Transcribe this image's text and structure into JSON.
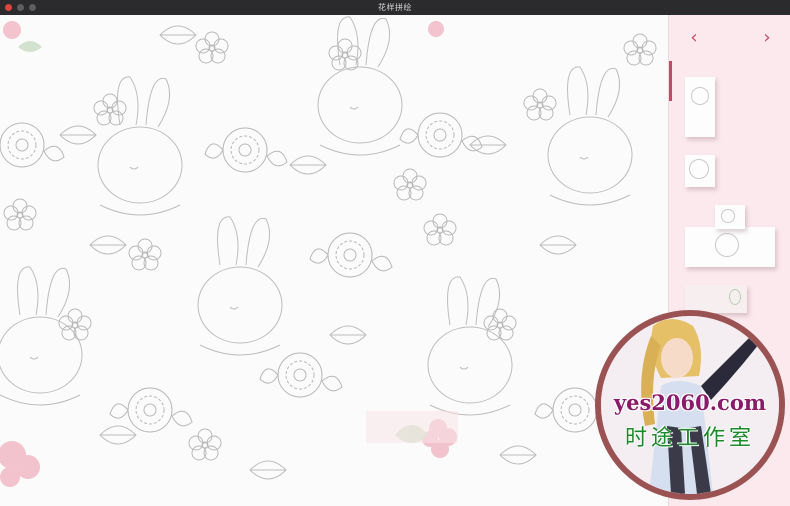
{
  "window": {
    "title": "花样拼绘"
  },
  "tray": {
    "prev_label": "‹",
    "next_label": "›",
    "pieces_visible": 5
  },
  "watermark": {
    "url": "yes2060.com",
    "studio": "时途工作室"
  },
  "colors": {
    "accent": "#c24a66",
    "tray_bg": "#fbe9ee",
    "titlebar": "#2b2b2d",
    "line_art": "#bdbdbd",
    "petal_pink": "#f1b9c6",
    "leaf_green": "#c9dcc4"
  }
}
